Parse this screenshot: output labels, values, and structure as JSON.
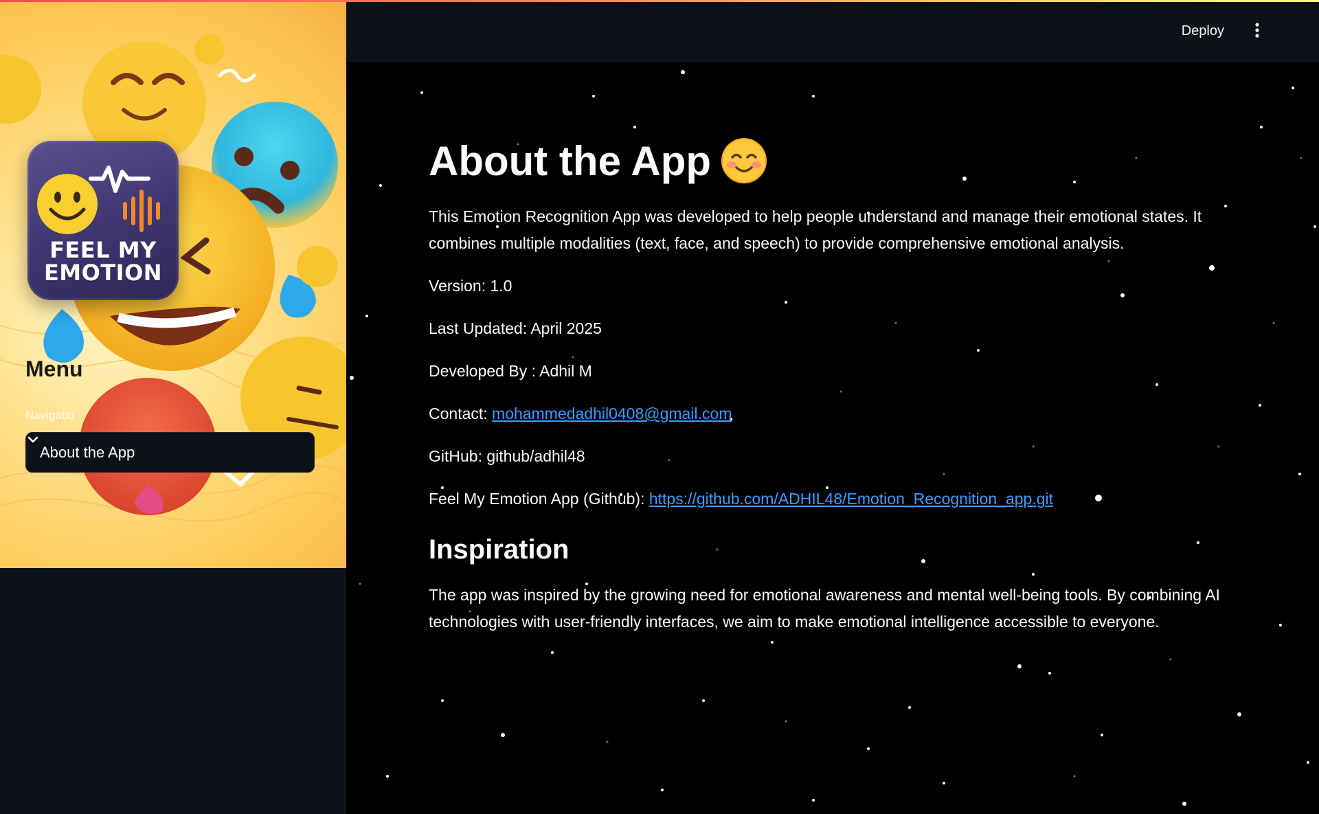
{
  "sidebar": {
    "logo": {
      "line1": "FEEL MY",
      "line2": "EMOTION"
    },
    "menu_title": "Menu",
    "nav_label": "Navigatio",
    "nav_select": {
      "value": "About the App",
      "icon": "chevron-down-icon"
    }
  },
  "header": {
    "deploy_label": "Deploy",
    "menu_icon": "kebab-menu-icon"
  },
  "main": {
    "title": "About the App",
    "title_emoji": "smiling-face-with-smiling-eyes-icon",
    "intro": "This Emotion Recognition App was developed to help people understand and manage their emotional states. It combines multiple modalities (text, face, and speech) to provide comprehensive emotional analysis.",
    "version": "Version: 1.0",
    "last_updated": "Last Updated: April 2025",
    "developed_by": "Developed By : Adhil M",
    "contact": {
      "label": "Contact: ",
      "email": "mohammedadhil0408@gmail.com"
    },
    "github": "GitHub: github/adhil48",
    "app_repo": {
      "label": "Feel My Emotion App (Github): ",
      "url": "https://github.com/ADHIL48/Emotion_Recognition_app.git"
    },
    "inspiration": {
      "heading": "Inspiration",
      "text": "The app was inspired by the growing need for emotional awareness and mental well-being tools. By combining AI technologies with user-friendly interfaces, we aim to make emotional intelligence accessible to everyone."
    }
  },
  "colors": {
    "link": "#3b9cff",
    "sidebar_bg": "#0e1117",
    "main_bg": "#000000",
    "accent_stripe_start": "#ff4b4b",
    "accent_stripe_end": "#fffd80"
  }
}
